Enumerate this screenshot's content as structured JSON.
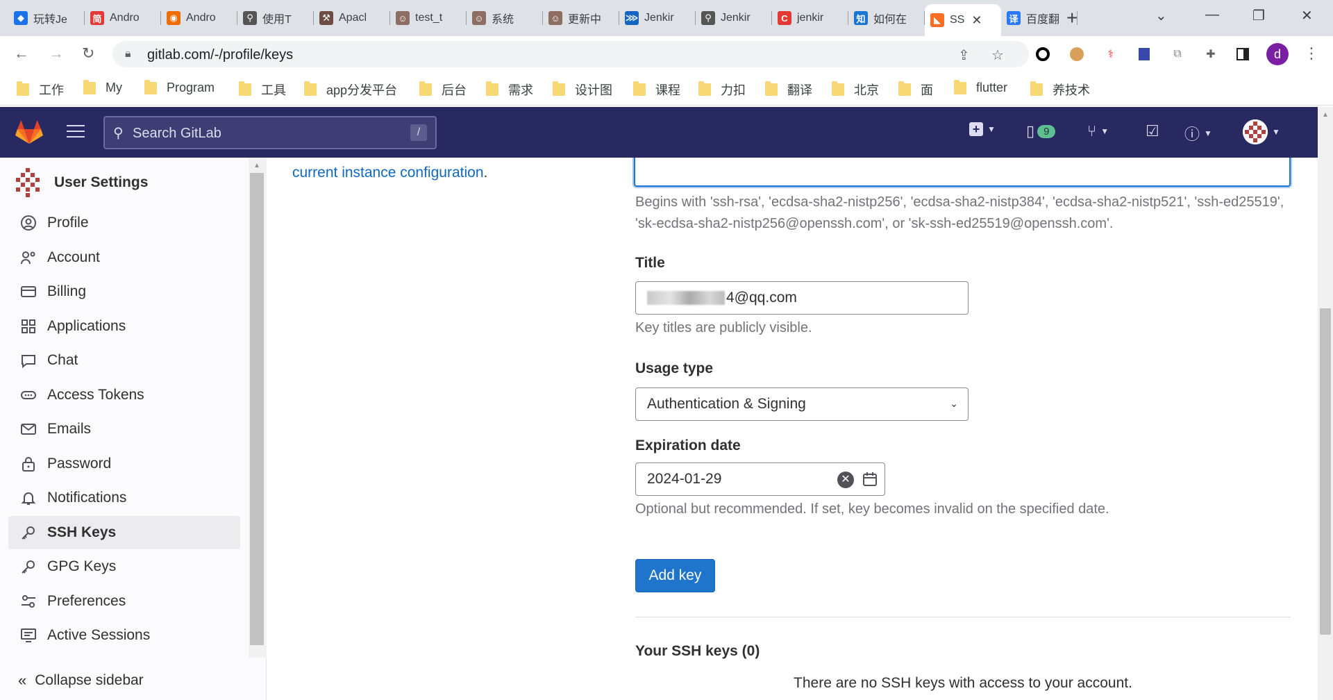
{
  "browser": {
    "tabs": [
      {
        "title": "玩转Je",
        "color": "#1a73e8"
      },
      {
        "title": "Andro",
        "color": "#e53935"
      },
      {
        "title": "Andro",
        "color": "#ef6c00"
      },
      {
        "title": "使用T",
        "color": "#555555"
      },
      {
        "title": "Apacl",
        "color": "#6d4c41"
      },
      {
        "title": "test_t",
        "color": "#8d6e63"
      },
      {
        "title": "系统",
        "color": "#8d6e63"
      },
      {
        "title": "更新中",
        "color": "#8d6e63"
      },
      {
        "title": "Jenkir",
        "color": "#1565c0"
      },
      {
        "title": "Jenkir",
        "color": "#555555"
      },
      {
        "title": "jenkir",
        "color": "#e53935"
      },
      {
        "title": "如何在",
        "color": "#1976d2"
      },
      {
        "title": "SS",
        "color": "#fc6d26",
        "active": true
      },
      {
        "title": "百度翻",
        "color": "#2979ff"
      }
    ],
    "tab_favicon_glyphs": [
      "◆",
      "简",
      "◉",
      "⚲",
      "⚒",
      "☺",
      "☺",
      "☺",
      "⋙",
      "⚲",
      "C",
      "知",
      "◣",
      "译"
    ],
    "new_tab_label": "+",
    "url": "gitlab.com/-/profile/keys",
    "bookmarks": [
      "工作",
      "My",
      "Program",
      "工具",
      "app分发平台",
      "后台",
      "需求",
      "设计图",
      "课程",
      "力扣",
      "翻译",
      "北京",
      "面",
      "flutter",
      "养技术"
    ],
    "profile_initial": "d"
  },
  "gitlab_header": {
    "search_placeholder": "Search GitLab",
    "search_shortcut": "/",
    "issues_count": "9"
  },
  "sidebar": {
    "title": "User Settings",
    "items": [
      {
        "label": "Profile",
        "icon": "profile-icon"
      },
      {
        "label": "Account",
        "icon": "account-icon"
      },
      {
        "label": "Billing",
        "icon": "billing-icon"
      },
      {
        "label": "Applications",
        "icon": "applications-icon"
      },
      {
        "label": "Chat",
        "icon": "chat-icon"
      },
      {
        "label": "Access Tokens",
        "icon": "token-icon"
      },
      {
        "label": "Emails",
        "icon": "mail-icon"
      },
      {
        "label": "Password",
        "icon": "lock-icon"
      },
      {
        "label": "Notifications",
        "icon": "bell-icon"
      },
      {
        "label": "SSH Keys",
        "icon": "key-icon",
        "active": true
      },
      {
        "label": "GPG Keys",
        "icon": "key-icon"
      },
      {
        "label": "Preferences",
        "icon": "preferences-icon"
      },
      {
        "label": "Active Sessions",
        "icon": "monitor-icon"
      }
    ],
    "collapse_label": "Collapse sidebar"
  },
  "main": {
    "config_link": "current instance configuration",
    "config_link_suffix": ".",
    "key_help": "Begins with 'ssh-rsa', 'ecdsa-sha2-nistp256', 'ecdsa-sha2-nistp384', 'ecdsa-sha2-nistp521', 'ssh-ed25519', 'sk-ecdsa-sha2-nistp256@openssh.com', or 'sk-ssh-ed25519@openssh.com'.",
    "title_label": "Title",
    "title_value_visible": "4@qq.com",
    "title_help": "Key titles are publicly visible.",
    "usage_label": "Usage type",
    "usage_value": "Authentication & Signing",
    "expiration_label": "Expiration date",
    "expiration_value": "2024-01-29",
    "expiration_help": "Optional but recommended. If set, key becomes invalid on the specified date.",
    "add_key_button": "Add key",
    "your_keys_heading": "Your SSH keys (0)",
    "empty_message": "There are no SSH keys with access to your account."
  }
}
